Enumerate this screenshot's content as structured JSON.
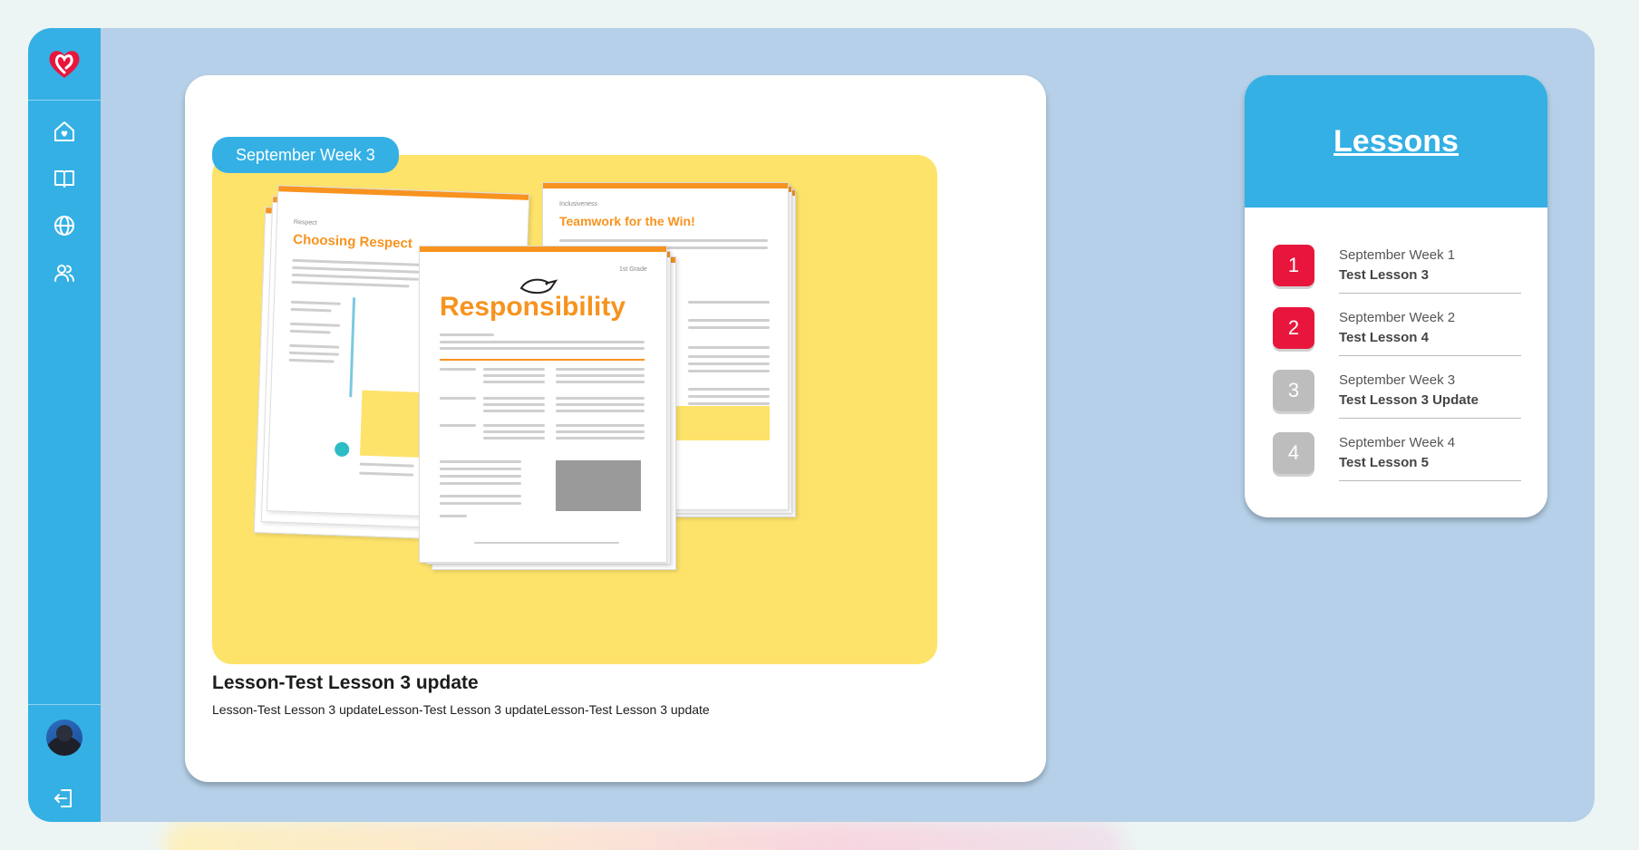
{
  "sidebar": {
    "logo_icon": "heart-logo-icon",
    "nav": [
      "home-icon",
      "book-icon",
      "globe-icon",
      "users-icon"
    ],
    "logout_icon": "logout-icon"
  },
  "main": {
    "badge": "September Week 3",
    "title": "Lesson-Test Lesson 3 update",
    "description": "Lesson-Test Lesson 3 updateLesson-Test Lesson 3 updateLesson-Test Lesson 3 update",
    "preview": {
      "left_doc_title": "Choosing Respect",
      "left_doc_label": "Respect",
      "right_doc_title": "Teamwork for the Win!",
      "right_doc_label": "Inclusiveness",
      "center_doc_title": "Responsibility",
      "center_doc_grade": "1st Grade"
    }
  },
  "lessons": {
    "heading": "Lessons",
    "items": [
      {
        "number": "1",
        "week": "September Week 1",
        "name": "Test Lesson 3",
        "color": "#e8163d"
      },
      {
        "number": "2",
        "week": "September Week 2",
        "name": "Test Lesson 4",
        "color": "#e8163d"
      },
      {
        "number": "3",
        "week": "September Week 3",
        "name": "Test Lesson 3 Update",
        "color": "#bdbdbd"
      },
      {
        "number": "4",
        "week": "September Week 4",
        "name": "Test Lesson 5",
        "color": "#bdbdbd"
      }
    ]
  },
  "colors": {
    "accent": "#34b0e4",
    "active": "#e8163d",
    "inactive": "#bdbdbd",
    "hero": "#fde36a"
  }
}
